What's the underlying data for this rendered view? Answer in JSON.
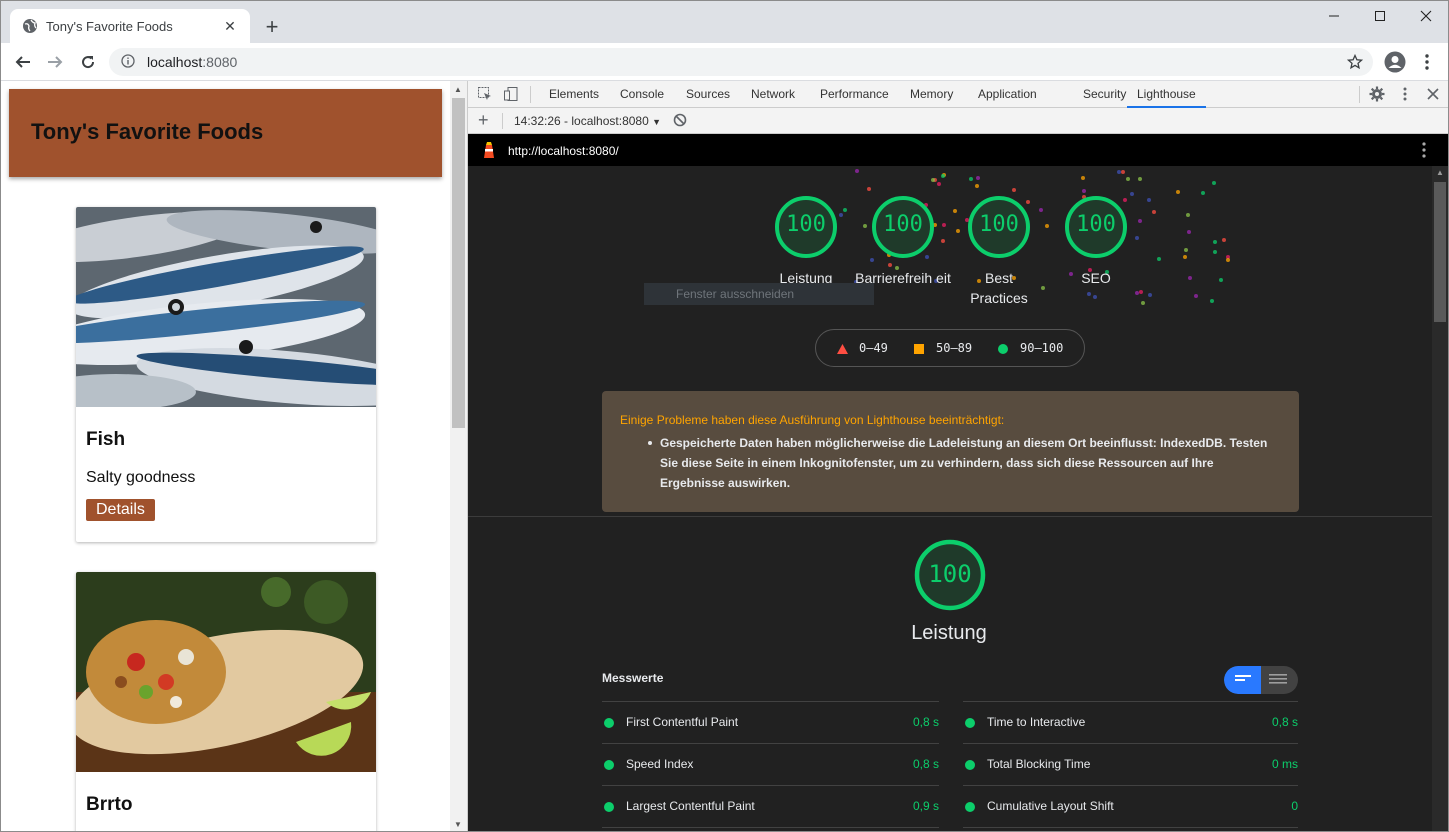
{
  "browser": {
    "tab_title": "Tony's Favorite Foods",
    "url_host": "localhost",
    "url_port": ":8080"
  },
  "page": {
    "header_title": "Tony's Favorite Foods",
    "cards": [
      {
        "name": "Fish",
        "description": "Salty goodness",
        "button": "Details"
      },
      {
        "name": "Brrto"
      }
    ]
  },
  "devtools": {
    "tabs": [
      "Elements",
      "Console",
      "Sources",
      "Network",
      "Performance",
      "Memory",
      "Application",
      "Security",
      "Lighthouse"
    ],
    "active_tab": "Lighthouse",
    "report_selector": "14:32:26 - localhost:8080",
    "lighthouse_url": "http://localhost:8080/"
  },
  "lighthouse": {
    "scores": [
      {
        "value": "100",
        "label": "Leistung"
      },
      {
        "value": "100",
        "label": "Barrierefreih eit"
      },
      {
        "value": "100",
        "label": "Best Practices"
      },
      {
        "value": "100",
        "label": "SEO"
      }
    ],
    "tooltip": "Fenster ausschneiden",
    "legend": [
      {
        "range": "0–49",
        "color": "#ff4e42",
        "shape": "triangle"
      },
      {
        "range": "50–89",
        "color": "#ffa400",
        "shape": "square"
      },
      {
        "range": "90–100",
        "color": "#0cce6b",
        "shape": "circle"
      }
    ],
    "warning": {
      "heading": "Einige Probleme haben diese Ausführung von Lighthouse beeinträchtigt:",
      "item": "Gespeicherte Daten haben möglicherweise die Ladeleistung an diesem Ort beeinflusst: IndexedDB. Testen Sie diese Seite in einem Inkognitofenster, um zu verhindern, dass sich diese Ressourcen auf Ihre Ergebnisse auswirken."
    },
    "performance": {
      "score": "100",
      "title": "Leistung",
      "metrics_title": "Messwerte",
      "metrics": [
        {
          "name": "First Contentful Paint",
          "value": "0,8 s"
        },
        {
          "name": "Time to Interactive",
          "value": "0,8 s"
        },
        {
          "name": "Speed Index",
          "value": "0,8 s"
        },
        {
          "name": "Total Blocking Time",
          "value": "0 ms"
        },
        {
          "name": "Largest Contentful Paint",
          "value": "0,9 s"
        },
        {
          "name": "Cumulative Layout Shift",
          "value": "0"
        }
      ]
    },
    "colors": {
      "pass": "#0cce6b",
      "average": "#ffa400",
      "fail": "#ff4e42",
      "accent": "#2979ff"
    }
  }
}
